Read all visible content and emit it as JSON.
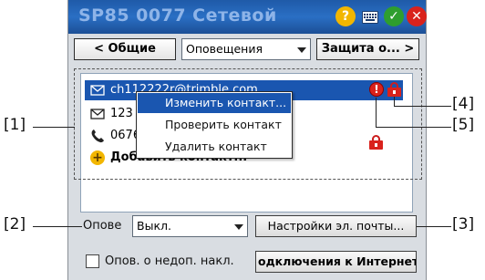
{
  "title": "SP85 0077 Сетевой",
  "title_buttons": {
    "help": "?",
    "ok": "✓",
    "close": "✕"
  },
  "nav": {
    "prev": "< Общие",
    "dropdown": "Оповещения",
    "next": "Защита о... >"
  },
  "contacts": [
    {
      "icon": "email-icon",
      "text": "ch112222r@trimble.com"
    },
    {
      "icon": "email-icon",
      "text": "123"
    },
    {
      "icon": "phone-icon",
      "text": "0676"
    }
  ],
  "add_contact": "Добавить контакт...",
  "context_menu": [
    "Изменить контакт...",
    "Проверить контакт",
    "Удалить контакт"
  ],
  "status_icons": {
    "warning": "!"
  },
  "notify_label": "Опове",
  "notify_select": "Выкл.",
  "email_settings": "Настройки эл. почты...",
  "checkbox_label": "Опов. о недоп. накл.",
  "connect_btn": "одключения к Интернету",
  "callouts": {
    "c1": "[1]",
    "c2": "[2]",
    "c3": "[3]",
    "c4": "[4]",
    "c5": "[5]"
  },
  "colors": {
    "title_bar": "#2a6fc4",
    "selection": "#1a56b0",
    "alert": "#d9221c",
    "ok_green": "#2e9e2e",
    "help_yellow": "#f2b600"
  }
}
